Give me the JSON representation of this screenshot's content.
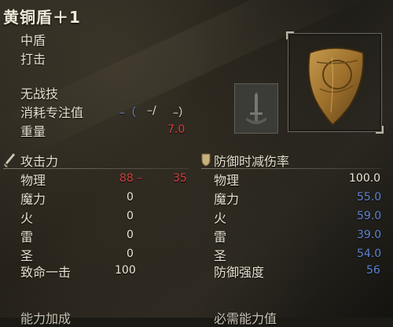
{
  "item": {
    "title": "黄铜盾＋1",
    "type": "中盾",
    "attack_type": "打击",
    "skill": "无战技",
    "fp_label": "消耗专注值",
    "fp_values": [
      "–（",
      "–/",
      "–）"
    ],
    "weight_label": "重量",
    "weight_value": "7.0"
  },
  "attack": {
    "header": "攻击力",
    "rows": [
      {
        "label": "物理",
        "value": "88",
        "extra_sep": "–",
        "extra": "35"
      },
      {
        "label": "魔力",
        "value": "0"
      },
      {
        "label": "火",
        "value": "0"
      },
      {
        "label": "雷",
        "value": "0"
      },
      {
        "label": "圣",
        "value": "0"
      },
      {
        "label": "致命一击",
        "value": "100"
      }
    ]
  },
  "defense": {
    "header": "防御时减伤率",
    "rows": [
      {
        "label": "物理",
        "value": "100.0"
      },
      {
        "label": "魔力",
        "value": "55.0"
      },
      {
        "label": "火",
        "value": "59.0"
      },
      {
        "label": "雷",
        "value": "39.0"
      },
      {
        "label": "圣",
        "value": "54.0"
      },
      {
        "label": "防御强度",
        "value": "56"
      }
    ]
  },
  "bottom": {
    "left_cut": "能力加成",
    "right_cut": "必需能力值"
  },
  "icons": {
    "attack_icon": "sword-icon",
    "defense_icon": "shield-icon",
    "skill_icon": "skill-sword-icon",
    "item_image": "brass-shield-icon"
  },
  "colors": {
    "red": "#d33f3f",
    "blue": "#5f85d2",
    "text": "#e6dfcf"
  }
}
